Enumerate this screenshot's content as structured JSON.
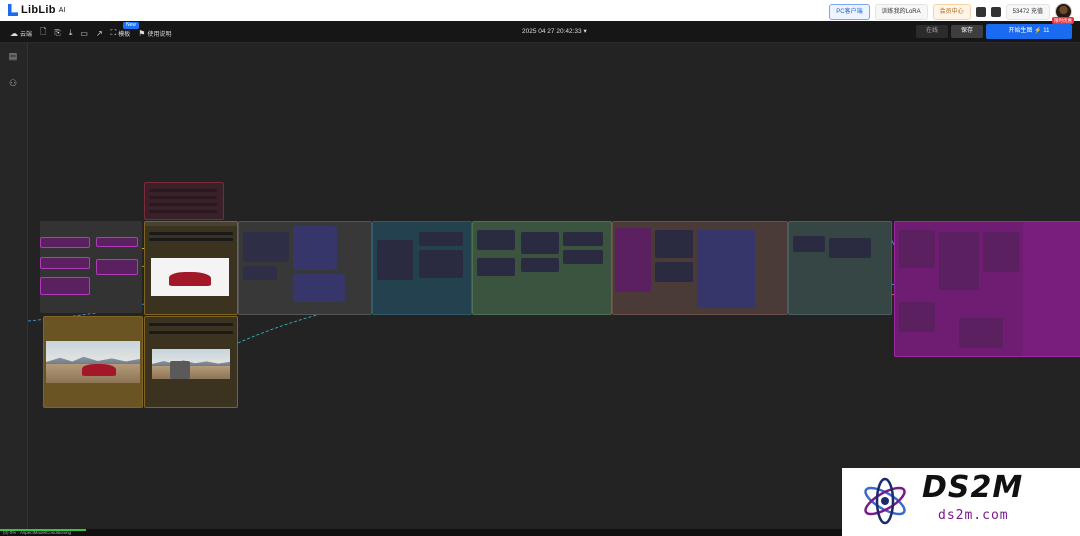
{
  "app": {
    "logo_text": "LibLib",
    "logo_suffix": "AI"
  },
  "topbar": {
    "pc_client": "PC客户端",
    "train_lora": "训练我的LoRA",
    "member_center": "会员中心",
    "points": "53472 充值"
  },
  "toolbar": {
    "cloud_label": "云端",
    "new_badge": "New",
    "template_label": "模板",
    "workflow_label": "使用说明",
    "datetime": "2025 04 27 20:42:33",
    "toggle_online": "在线",
    "toggle_save": "保存",
    "generate_label": "开始生图 ⚡ 11",
    "generate_badge": "限时优惠"
  },
  "status": {
    "progress_fraction": 0.08,
    "status_text": "(0) 0% · AspectModelConditioning"
  },
  "watermark": {
    "brand": "DS2M",
    "domain": "ds2m.com"
  },
  "colors": {
    "accent": "#1a6bf0",
    "node_purple": "#7a2a82",
    "node_brown": "#6b5423",
    "node_green": "#3c5a3c",
    "node_teal": "#1f4a5a",
    "node_gray": "#3a3a3a",
    "node_magenta": "#8a1f8e"
  }
}
